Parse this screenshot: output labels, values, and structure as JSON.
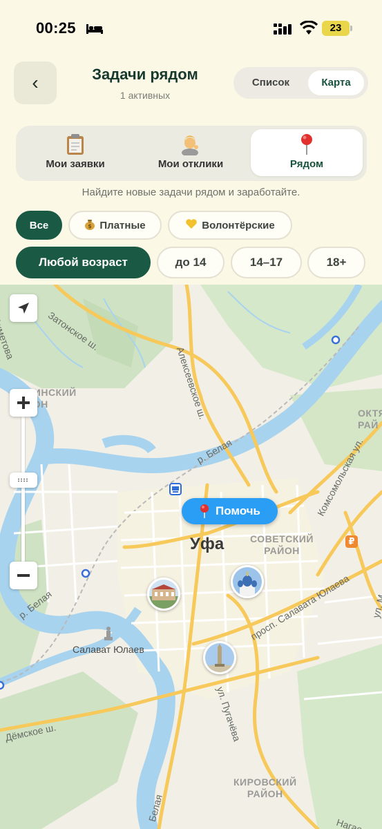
{
  "status_bar": {
    "time": "00:25",
    "battery": "23"
  },
  "header": {
    "back_label": "‹",
    "title": "Задачи рядом",
    "subtitle": "1 активных"
  },
  "view_toggle": {
    "list_label": "Список",
    "map_label": "Карта",
    "selected": "Карта"
  },
  "tabs": [
    {
      "label": "Мои заявки",
      "icon": "clipboard-icon"
    },
    {
      "label": "Мои отклики",
      "icon": "person-icon"
    },
    {
      "label": "Рядом",
      "icon": "pin-icon",
      "active": true
    }
  ],
  "hint": "Найдите новые задачи рядом и заработайте.",
  "filters": {
    "type": [
      {
        "label": "Все",
        "active": true
      },
      {
        "label": "Платные",
        "icon": "money-bag-icon"
      },
      {
        "label": "Волонтёрские",
        "icon": "yellow-heart-icon"
      }
    ],
    "age": [
      {
        "label": "Любой возраст",
        "active": true
      },
      {
        "label": "до 14"
      },
      {
        "label": "14–17"
      },
      {
        "label": "18+"
      }
    ]
  },
  "map": {
    "city": "Уфа",
    "help_marker": "Помочь",
    "labels": {
      "zatonskoe": "Затонское ш.",
      "alekseevskoe": "Алексеевское ш.",
      "belaya1": "р. Белая",
      "belaya2": "р. Белая",
      "belaya3": "Белая",
      "komsomolskaya": "Комсомольская ул.",
      "salavat_prosp": "просп. Салавата Юлаева",
      "pugacheva": "ул. Пугачёва",
      "demskoe": "Дёмское ш.",
      "salavat_monument": "Салават Юлаев",
      "ahmetova": "Ахметова",
      "nagaevo": "Нагае",
      "ul_m": "ул. М"
    },
    "districts": {
      "leninsky": "ЛЕНИНСКИЙ\nРАЙОН",
      "sovetsky": "СОВЕТСКИЙ\nРАЙОН",
      "oktyabrsky": "ОКТЯ\nРАЙ",
      "kirovsky": "КИРОВСКИЙ\nРАЙОН"
    },
    "colors": {
      "water": "#a7d3ef",
      "green": "#cfe3c4",
      "road": "#f7c85a",
      "accent": "#1a5a44",
      "marker": "#2a9df4"
    }
  }
}
